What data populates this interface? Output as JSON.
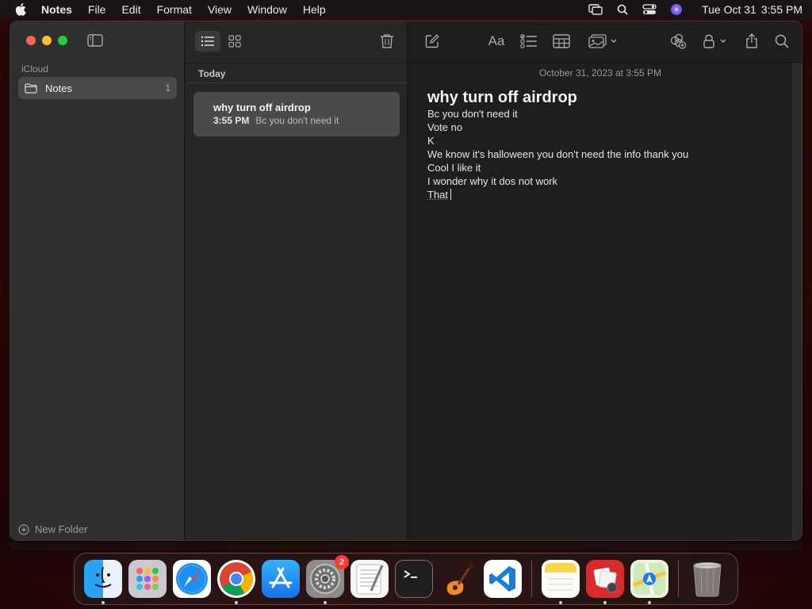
{
  "menubar": {
    "app_name": "Notes",
    "items": [
      "File",
      "Edit",
      "Format",
      "View",
      "Window",
      "Help"
    ],
    "date": "Tue Oct 31",
    "time": "3:55 PM"
  },
  "sidebar": {
    "section_label": "iCloud",
    "folders": [
      {
        "name": "Notes",
        "count": "1"
      }
    ],
    "new_folder_label": "New Folder"
  },
  "notelist": {
    "section_label": "Today",
    "notes": [
      {
        "title": "why turn off airdrop",
        "time": "3:55 PM",
        "preview": "Bc you don't need it"
      }
    ]
  },
  "editor": {
    "date": "October 31, 2023 at 3:55 PM",
    "heading": "why turn off airdrop",
    "lines": [
      "Bc you don't need it",
      "Vote no",
      "K",
      "We know it's halloween you don't need the info thank you",
      "Cool I like it",
      "I wonder why it dos not work",
      "That"
    ],
    "format_label": "Aa"
  },
  "dock": {
    "apps": [
      "Finder",
      "Launchpad",
      "Safari",
      "Chrome",
      "App Store",
      "System Settings",
      "TextEdit",
      "Terminal",
      "GarageBand",
      "Visual Studio Code",
      "Notes",
      "Photo Booth",
      "Maps",
      "Trash"
    ],
    "system_settings_badge": "2"
  },
  "colors": {
    "close": "#fe5f57",
    "minimize": "#febc2e",
    "maximize": "#28c840",
    "badge": "#ff3b30",
    "accent": "#4a90e2"
  }
}
